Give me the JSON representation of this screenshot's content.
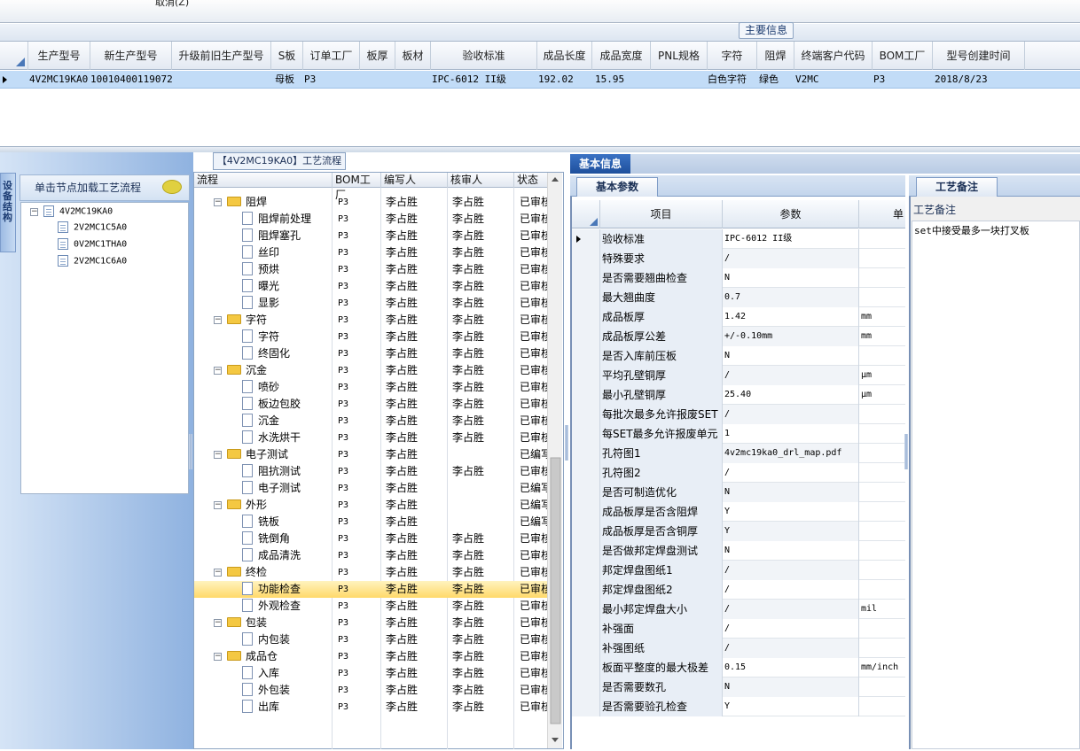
{
  "toolbar": {
    "cancel_label": "取消(Z)"
  },
  "main_info_tab": "主要信息",
  "grid": {
    "columns": [
      "生产型号",
      "新生产型号",
      "升级前旧生产型号",
      "S板",
      "订单工厂",
      "板厚",
      "板材",
      "验收标准",
      "成品长度",
      "成品宽度",
      "PNL规格",
      "字符",
      "阻焊",
      "终端客户代码",
      "BOM工厂",
      "型号创建时间"
    ],
    "row": {
      "生产型号": "4V2MC19KA0",
      "新生产型号": "10010400119072",
      "升级前旧生产型号": "",
      "S板": "母板",
      "订单工厂": "P3",
      "板厚": "",
      "板材": "",
      "验收标准": "IPC-6012 II级",
      "成品长度": "192.02",
      "成品宽度": "15.95",
      "PNL规格": "",
      "字符": "白色字符",
      "阻焊": "绿色",
      "终端客户代码": "V2MC",
      "BOM工厂": "P3",
      "型号创建时间": "2018/8/23"
    }
  },
  "left": {
    "vertical_tab": "设备结构",
    "tree_title": "单击节点加载工艺流程",
    "tree": {
      "root": "4V2MC19KA0",
      "children": [
        "2V2MC1C5A0",
        "0V2MC1THA0",
        "2V2MC1C6A0"
      ]
    }
  },
  "flow": {
    "tab_title": "【4V2MC19KA0】工艺流程",
    "columns": [
      "流程",
      "BOM工厂",
      "编写人",
      "核审人",
      "状态"
    ],
    "rows": [
      {
        "level": 0,
        "name": "阻焊",
        "factory": "P3",
        "writer": "李占胜",
        "reviewer": "李占胜",
        "status": "已审核"
      },
      {
        "level": 1,
        "name": "阻焊前处理",
        "factory": "P3",
        "writer": "李占胜",
        "reviewer": "李占胜",
        "status": "已审核"
      },
      {
        "level": 1,
        "name": "阻焊塞孔",
        "factory": "P3",
        "writer": "李占胜",
        "reviewer": "李占胜",
        "status": "已审核"
      },
      {
        "level": 1,
        "name": "丝印",
        "factory": "P3",
        "writer": "李占胜",
        "reviewer": "李占胜",
        "status": "已审核"
      },
      {
        "level": 1,
        "name": "预烘",
        "factory": "P3",
        "writer": "李占胜",
        "reviewer": "李占胜",
        "status": "已审核"
      },
      {
        "level": 1,
        "name": "曝光",
        "factory": "P3",
        "writer": "李占胜",
        "reviewer": "李占胜",
        "status": "已审核"
      },
      {
        "level": 1,
        "name": "显影",
        "factory": "P3",
        "writer": "李占胜",
        "reviewer": "李占胜",
        "status": "已审核"
      },
      {
        "level": 0,
        "name": "字符",
        "factory": "P3",
        "writer": "李占胜",
        "reviewer": "李占胜",
        "status": "已审核"
      },
      {
        "level": 1,
        "name": "字符",
        "factory": "P3",
        "writer": "李占胜",
        "reviewer": "李占胜",
        "status": "已审核"
      },
      {
        "level": 1,
        "name": "终固化",
        "factory": "P3",
        "writer": "李占胜",
        "reviewer": "李占胜",
        "status": "已审核"
      },
      {
        "level": 0,
        "name": "沉金",
        "factory": "P3",
        "writer": "李占胜",
        "reviewer": "李占胜",
        "status": "已审核"
      },
      {
        "level": 1,
        "name": "喷砂",
        "factory": "P3",
        "writer": "李占胜",
        "reviewer": "李占胜",
        "status": "已审核"
      },
      {
        "level": 1,
        "name": "板边包胶",
        "factory": "P3",
        "writer": "李占胜",
        "reviewer": "李占胜",
        "status": "已审核"
      },
      {
        "level": 1,
        "name": "沉金",
        "factory": "P3",
        "writer": "李占胜",
        "reviewer": "李占胜",
        "status": "已审核"
      },
      {
        "level": 1,
        "name": "水洗烘干",
        "factory": "P3",
        "writer": "李占胜",
        "reviewer": "李占胜",
        "status": "已审核"
      },
      {
        "level": 0,
        "name": "电子测试",
        "factory": "P3",
        "writer": "李占胜",
        "reviewer": "",
        "status": "已编写"
      },
      {
        "level": 1,
        "name": "阻抗测试",
        "factory": "P3",
        "writer": "李占胜",
        "reviewer": "李占胜",
        "status": "已审核"
      },
      {
        "level": 1,
        "name": "电子测试",
        "factory": "P3",
        "writer": "李占胜",
        "reviewer": "",
        "status": "已编写"
      },
      {
        "level": 0,
        "name": "外形",
        "factory": "P3",
        "writer": "李占胜",
        "reviewer": "",
        "status": "已编写"
      },
      {
        "level": 1,
        "name": "铣板",
        "factory": "P3",
        "writer": "李占胜",
        "reviewer": "",
        "status": "已编写"
      },
      {
        "level": 1,
        "name": "铣倒角",
        "factory": "P3",
        "writer": "李占胜",
        "reviewer": "李占胜",
        "status": "已审核"
      },
      {
        "level": 1,
        "name": "成品清洗",
        "factory": "P3",
        "writer": "李占胜",
        "reviewer": "李占胜",
        "status": "已审核"
      },
      {
        "level": 0,
        "name": "终检",
        "factory": "P3",
        "writer": "李占胜",
        "reviewer": "李占胜",
        "status": "已审核"
      },
      {
        "level": 1,
        "name": "功能检查",
        "factory": "P3",
        "writer": "李占胜",
        "reviewer": "李占胜",
        "status": "已审核",
        "selected": true
      },
      {
        "level": 1,
        "name": "外观检查",
        "factory": "P3",
        "writer": "李占胜",
        "reviewer": "李占胜",
        "status": "已审核"
      },
      {
        "level": 0,
        "name": "包装",
        "factory": "P3",
        "writer": "李占胜",
        "reviewer": "李占胜",
        "status": "已审核"
      },
      {
        "level": 1,
        "name": "内包装",
        "factory": "P3",
        "writer": "李占胜",
        "reviewer": "李占胜",
        "status": "已审核"
      },
      {
        "level": 0,
        "name": "成品仓",
        "factory": "P3",
        "writer": "李占胜",
        "reviewer": "李占胜",
        "status": "已审核"
      },
      {
        "level": 1,
        "name": "入库",
        "factory": "P3",
        "writer": "李占胜",
        "reviewer": "李占胜",
        "status": "已审核"
      },
      {
        "level": 1,
        "name": "外包装",
        "factory": "P3",
        "writer": "李占胜",
        "reviewer": "李占胜",
        "status": "已审核"
      },
      {
        "level": 1,
        "name": "出库",
        "factory": "P3",
        "writer": "李占胜",
        "reviewer": "李占胜",
        "status": "已审核"
      }
    ]
  },
  "info": {
    "tab": "基本信息",
    "params_tab": "基本参数",
    "columns": [
      "项目",
      "参数",
      "单"
    ],
    "params": [
      {
        "k": "验收标准",
        "v": "IPC-6012 II级",
        "u": ""
      },
      {
        "k": "特殊要求",
        "v": "/",
        "u": ""
      },
      {
        "k": "是否需要翘曲检查",
        "v": "N",
        "u": ""
      },
      {
        "k": "最大翘曲度",
        "v": "0.7",
        "u": ""
      },
      {
        "k": "成品板厚",
        "v": "1.42",
        "u": "mm"
      },
      {
        "k": "成品板厚公差",
        "v": "+/-0.10mm",
        "u": "mm"
      },
      {
        "k": "是否入库前压板",
        "v": "N",
        "u": ""
      },
      {
        "k": "平均孔壁铜厚",
        "v": "/",
        "u": "μm"
      },
      {
        "k": "最小孔壁铜厚",
        "v": "25.40",
        "u": "μm"
      },
      {
        "k": "每批次最多允许报废SET",
        "v": "/",
        "u": ""
      },
      {
        "k": "每SET最多允许报废单元",
        "v": "1",
        "u": ""
      },
      {
        "k": "孔符图1",
        "v": "4v2mc19ka0_drl_map.pdf",
        "u": ""
      },
      {
        "k": "孔符图2",
        "v": "/",
        "u": ""
      },
      {
        "k": "是否可制造优化",
        "v": "N",
        "u": ""
      },
      {
        "k": "成品板厚是否含阻焊",
        "v": "Y",
        "u": ""
      },
      {
        "k": "成品板厚是否含铜厚",
        "v": "Y",
        "u": ""
      },
      {
        "k": "是否做邦定焊盘测试",
        "v": "N",
        "u": ""
      },
      {
        "k": "邦定焊盘图纸1",
        "v": "/",
        "u": ""
      },
      {
        "k": "邦定焊盘图纸2",
        "v": "/",
        "u": ""
      },
      {
        "k": "最小邦定焊盘大小",
        "v": "/",
        "u": "mil"
      },
      {
        "k": "补强面",
        "v": "/",
        "u": ""
      },
      {
        "k": "补强图纸",
        "v": "/",
        "u": ""
      },
      {
        "k": "板面平整度的最大极差",
        "v": "0.15",
        "u": "mm/inch"
      },
      {
        "k": "是否需要数孔",
        "v": "N",
        "u": ""
      },
      {
        "k": "是否需要验孔检查",
        "v": "Y",
        "u": ""
      }
    ],
    "remarks_tab": "工艺备注",
    "remarks_label": "工艺备注",
    "remarks_text": "set中接受最多一块打叉板"
  }
}
